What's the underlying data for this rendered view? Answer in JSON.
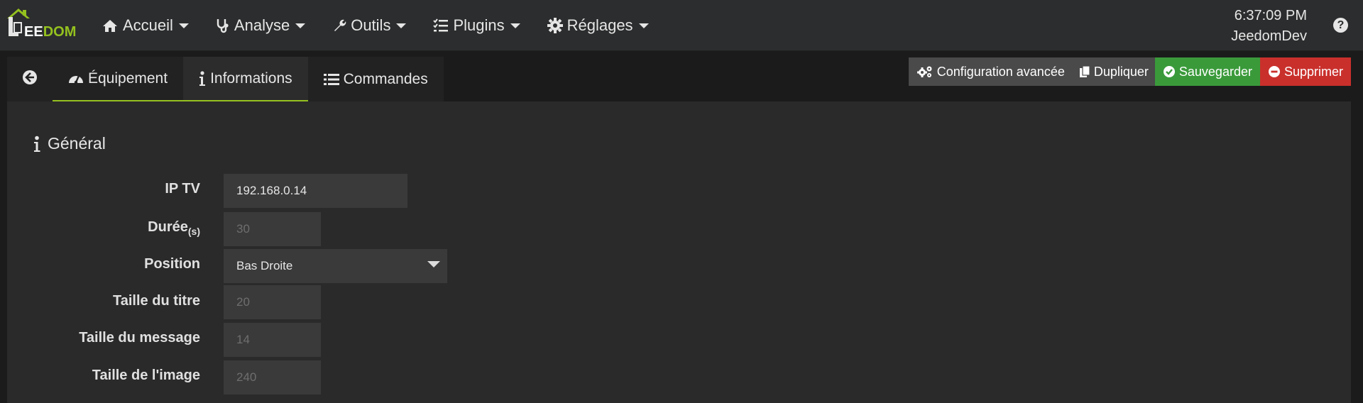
{
  "logo": {
    "text_white": "EE",
    "text_green": "DOM",
    "letter": "J"
  },
  "nav": {
    "items": [
      {
        "label": "Accueil",
        "icon": "home-icon"
      },
      {
        "label": "Analyse",
        "icon": "stethoscope-icon"
      },
      {
        "label": "Outils",
        "icon": "wrench-icon"
      },
      {
        "label": "Plugins",
        "icon": "tasks-icon"
      },
      {
        "label": "Réglages",
        "icon": "cog-icon"
      }
    ]
  },
  "header": {
    "time": "6:37:09 PM",
    "user": "JeedomDev",
    "help": "?"
  },
  "tabs": [
    {
      "label": "",
      "icon": "arrow-circle-left-icon"
    },
    {
      "label": "Équipement",
      "icon": "tachometer-icon"
    },
    {
      "label": "Informations",
      "icon": "info-icon"
    },
    {
      "label": "Commandes",
      "icon": "list-icon"
    }
  ],
  "actions": {
    "config": "Configuration avancée",
    "duplicate": "Dupliquer",
    "save": "Sauvegarder",
    "delete": "Supprimer"
  },
  "section": {
    "title": "Général",
    "icon": "info-icon"
  },
  "form": {
    "ip_label": "IP TV",
    "ip_value": "192.168.0.14",
    "duration_label": "Durée",
    "duration_unit": "(s)",
    "duration_placeholder": "30",
    "position_label": "Position",
    "position_value": "Bas Droite",
    "title_size_label": "Taille du titre",
    "title_size_placeholder": "20",
    "message_size_label": "Taille du message",
    "message_size_placeholder": "14",
    "image_size_label": "Taille de l'image",
    "image_size_placeholder": "240"
  },
  "colors": {
    "accent": "#94c11f",
    "save": "#3a9a3a",
    "delete": "#c9302c"
  }
}
